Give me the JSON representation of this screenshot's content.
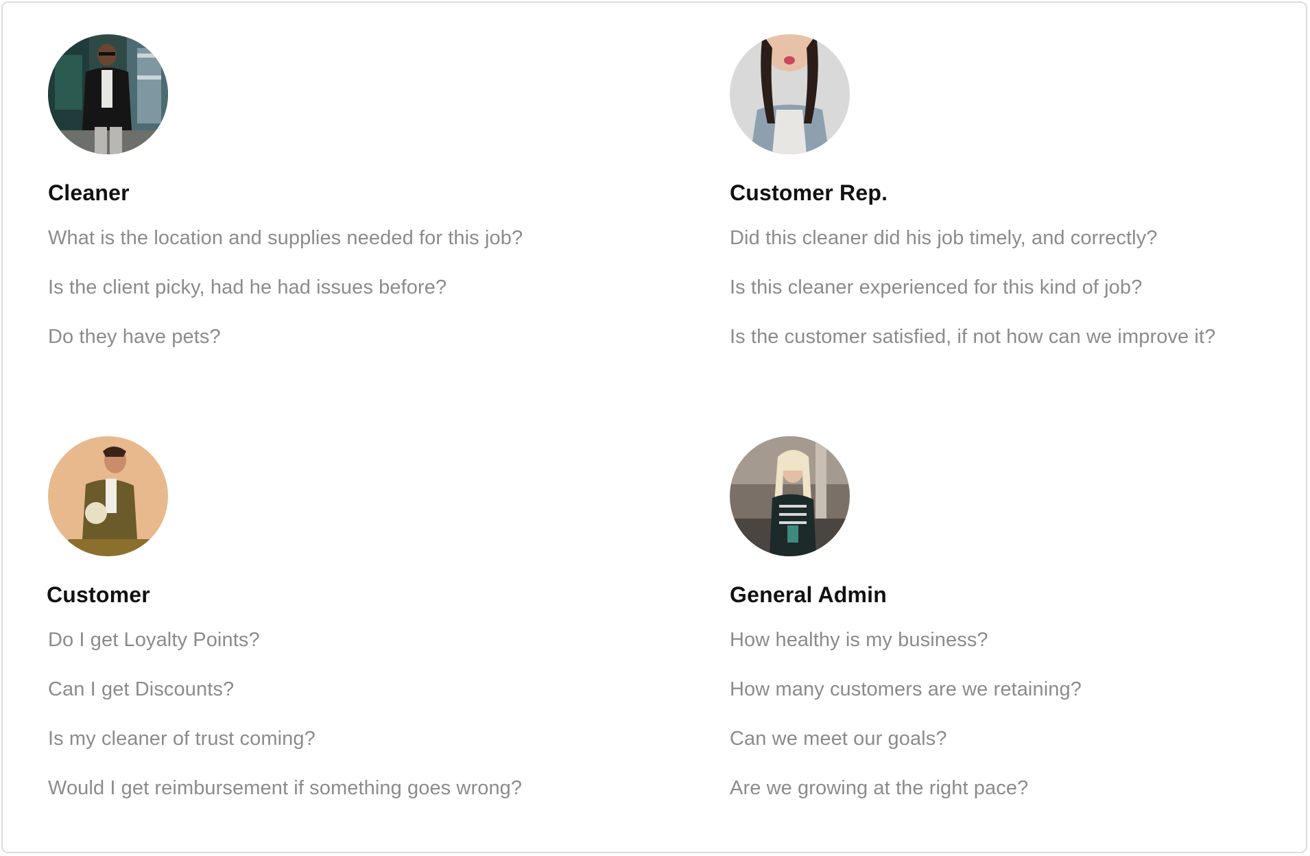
{
  "personas": [
    {
      "role": "Cleaner",
      "questions": [
        "What is the location and supplies needed for this job?",
        "Is the client picky, had he had issues before?",
        "Do they have pets?"
      ]
    },
    {
      "role": "Customer Rep.",
      "questions": [
        "Did this cleaner did his job timely, and correctly?",
        "Is this cleaner experienced for this kind of job?",
        "Is the customer satisfied, if not how can we improve it?"
      ]
    },
    {
      "role": "Customer",
      "questions": [
        "Do I get Loyalty Points?",
        "Can I get Discounts?",
        "Is my cleaner of trust coming?",
        "Would I get reimbursement if something goes wrong?"
      ]
    },
    {
      "role": "General Admin",
      "questions": [
        "How healthy is my business?",
        "How many customers are we retaining?",
        "Can we meet our goals?",
        "Are we growing at the right pace?"
      ]
    }
  ],
  "colors": {
    "title": "#111111",
    "question": "#8b8b8b",
    "border": "#dcdcdc"
  }
}
